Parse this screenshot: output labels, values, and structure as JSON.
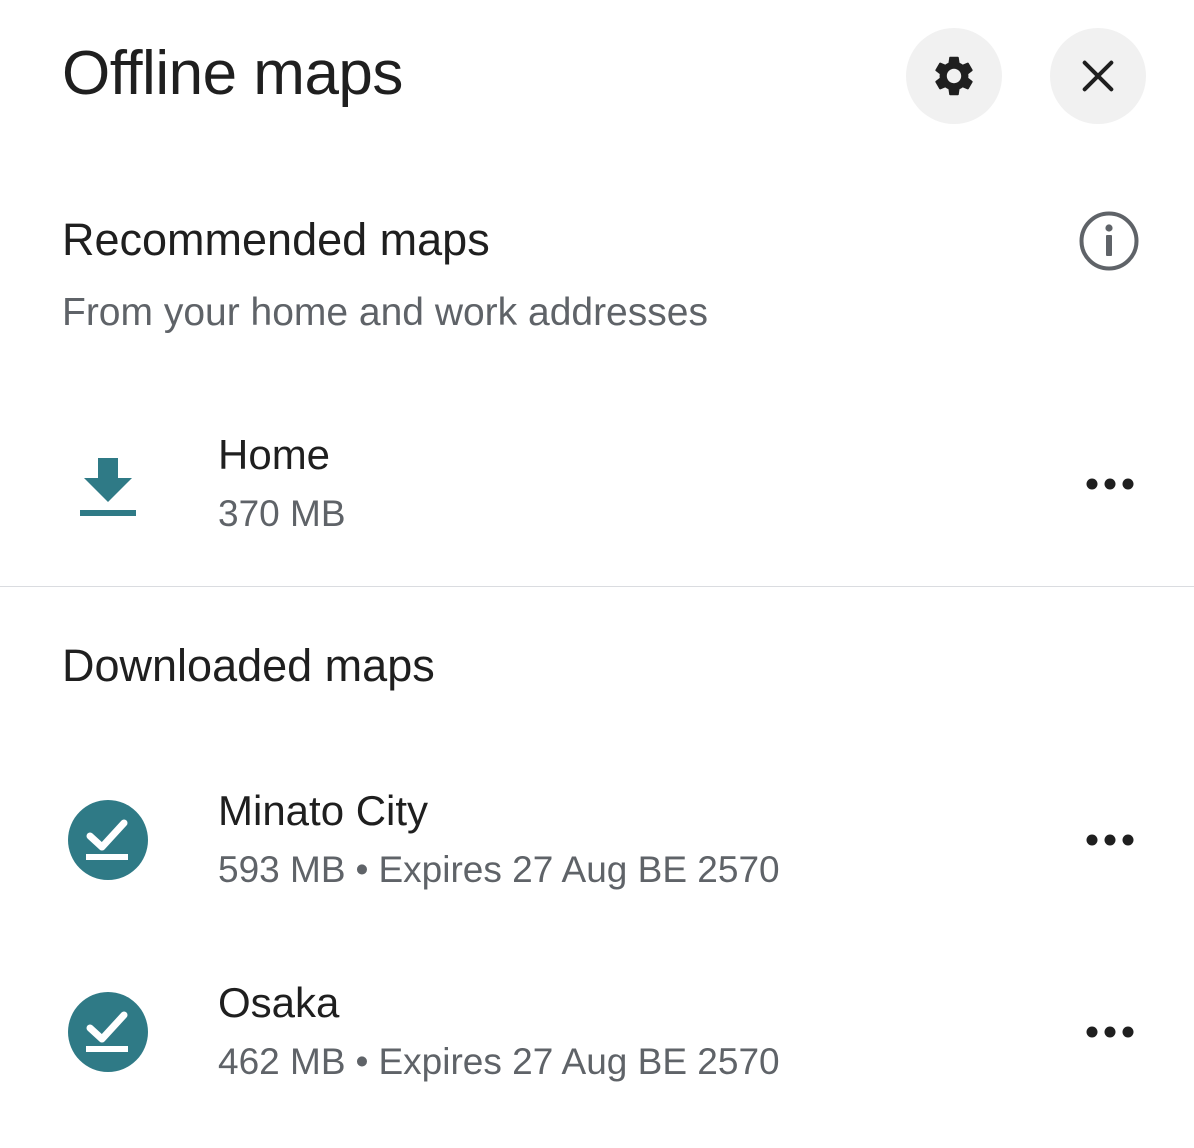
{
  "header": {
    "title": "Offline maps",
    "settings_icon": "gear-icon",
    "close_icon": "close-icon"
  },
  "recommended": {
    "title": "Recommended maps",
    "subtitle": "From your home and work addresses",
    "info_icon": "info-icon",
    "items": [
      {
        "name": "Home",
        "size": "370 MB",
        "icon": "download-icon"
      }
    ]
  },
  "downloaded": {
    "title": "Downloaded maps",
    "items": [
      {
        "name": "Minato City",
        "size": "593 MB",
        "separator": "•",
        "expires": "Expires 27 Aug BE 2570",
        "icon": "downloaded-check-icon"
      },
      {
        "name": "Osaka",
        "size": "462 MB",
        "separator": "•",
        "expires": "Expires 27 Aug BE 2570",
        "icon": "downloaded-check-icon"
      }
    ]
  },
  "colors": {
    "accent": "#2f7a86",
    "text_primary": "#1f1f1f",
    "text_secondary": "#5f6368",
    "button_bg": "#f1f1f1",
    "divider": "#dadce0"
  },
  "more_icon": "more-horizontal-icon"
}
